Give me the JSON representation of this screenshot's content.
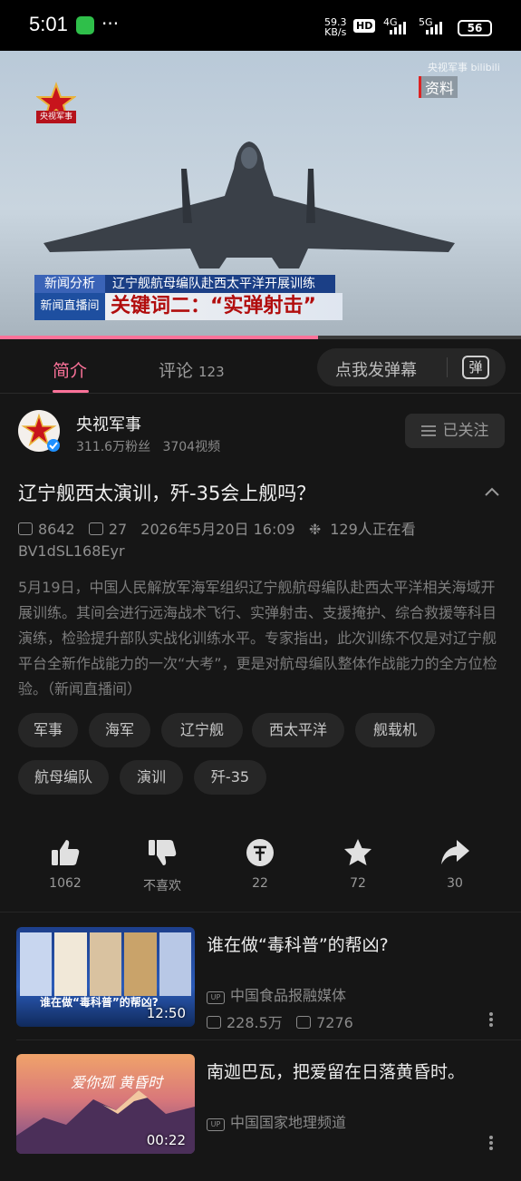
{
  "status_bar": {
    "time": "5:01",
    "net_speed_value": "59.3",
    "net_speed_unit": "KB/s",
    "hd_label": "HD",
    "sig1_label": "4G",
    "sig2_label": "5G",
    "battery": "56"
  },
  "video": {
    "channel_logo_text": "央视军事",
    "archive_label": "资料",
    "watermark": "央视军事 bilibili",
    "news_tag": "新闻分析",
    "news_headline": "辽宁舰航母编队赴西太平洋开展训练",
    "news_brand": "新闻直播间",
    "keyword_caption": "关键词二：“实弹射击”",
    "progress": 0.61
  },
  "tabs": {
    "intro": "简介",
    "comments": "评论",
    "comments_count": "123",
    "danmaku_placeholder": "点我发弹幕",
    "danmaku_icon_label": "弹"
  },
  "uploader": {
    "name": "央视军事",
    "fans": "311.6万粉丝",
    "videos": "3704视频",
    "follow_label": "已关注"
  },
  "video_info": {
    "title": "辽宁舰西太演训，歼-35会上舰吗？",
    "plays": "8642",
    "danmaku": "27",
    "datetime": "2026年5月20日 16:09",
    "watching": "129人正在看",
    "bvid": "BV1dSL168Eyr",
    "description": "5月19日，中国人民解放军海军组织辽宁舰航母编队赴西太平洋相关海域开展训练。其间会进行远海战术飞行、实弹射击、支援掩护、综合救援等科目演练，检验提升部队实战化训练水平。专家指出，此次训练不仅是对辽宁舰平台全新作战能力的一次“大考”，更是对航母编队整体作战能力的全方位检验。（新闻直播间）"
  },
  "tags": [
    "军事",
    "海军",
    "辽宁舰",
    "西太平洋",
    "舰载机",
    "航母编队",
    "演训",
    "歼-35"
  ],
  "actions": {
    "like": "1062",
    "dislike": "不喜欢",
    "coin": "22",
    "favorite": "72",
    "share": "30"
  },
  "recommendations": [
    {
      "title": "谁在做“毒科普”的帮凶?",
      "uploader": "中国食品报融媒体",
      "plays": "228.5万",
      "danmaku": "7276",
      "duration": "12:50",
      "thumb_caption": "谁在做“毒科普”的帮凶?"
    },
    {
      "title": "南迦巴瓦，把爱留在日落黄昏时。",
      "uploader": "中国国家地理频道",
      "duration": "00:22",
      "thumb_caption": "爱你孤 黄昏时"
    }
  ],
  "colors": {
    "accent_pink": "#fb7299",
    "background": "#161616"
  }
}
